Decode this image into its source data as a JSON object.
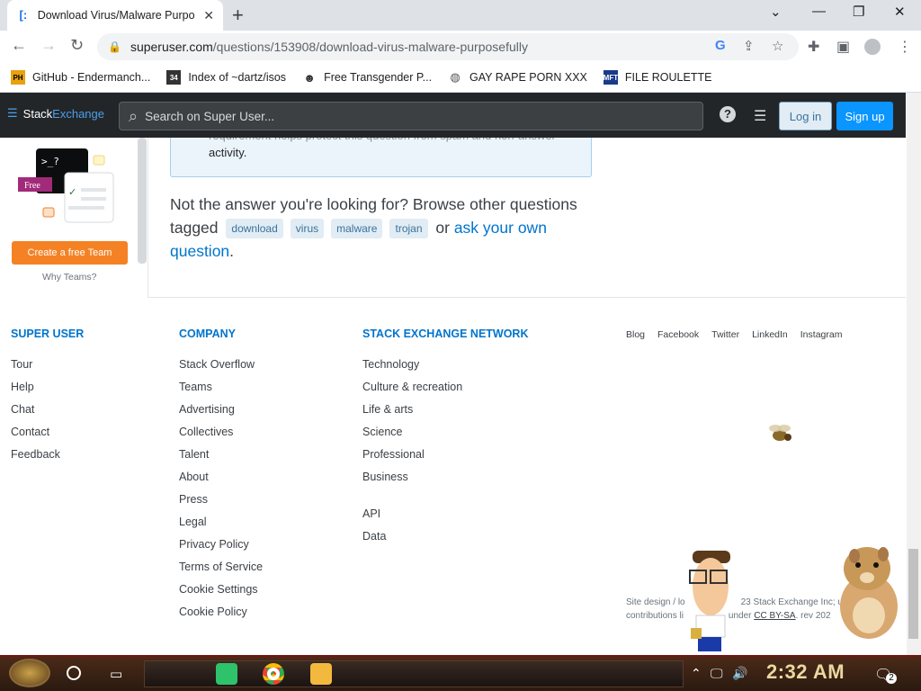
{
  "browser": {
    "tab_title": "Download Virus/Malware Purpos",
    "url_host": "superuser.com",
    "url_path": "/questions/153908/download-virus-malware-purposefully",
    "bookmarks": [
      {
        "label": "GitHub - Endermanch...",
        "icon": "PH"
      },
      {
        "label": "Index of ~dartz/isos",
        "icon": "34"
      },
      {
        "label": "Free Transgender P...",
        "icon": "mask"
      },
      {
        "label": "GAY RAPE PORN XXX",
        "icon": "globe"
      },
      {
        "label": "FILE ROULETTE",
        "icon": "MFT"
      }
    ]
  },
  "header": {
    "logo_stack": "Stack",
    "logo_exchange": "Exchange",
    "search_placeholder": "Search on Super User...",
    "login": "Log in",
    "signup": "Sign up"
  },
  "sidebar": {
    "free_badge": "Free",
    "prompt_glyph": ">_?",
    "create_team": "Create a free Team",
    "why_teams": "Why Teams?"
  },
  "main": {
    "notice_cut": "requirement helps protect this question from spam and non-answer",
    "notice_text": "activity.",
    "not_answer_prefix": "Not the answer you're looking for? Browse other questions tagged",
    "tags": [
      "download",
      "virus",
      "malware",
      "trojan"
    ],
    "or_text": "or",
    "ask_link": "ask your own question",
    "period": "."
  },
  "footer": {
    "col1_heading": "SUPER USER",
    "col1": [
      "Tour",
      "Help",
      "Chat",
      "Contact",
      "Feedback"
    ],
    "col2_heading": "COMPANY",
    "col2": [
      "Stack Overflow",
      "Teams",
      "Advertising",
      "Collectives",
      "Talent",
      "About",
      "Press",
      "Legal",
      "Privacy Policy",
      "Terms of Service",
      "Cookie Settings",
      "Cookie Policy"
    ],
    "col3_heading": "STACK EXCHANGE NETWORK",
    "col3": [
      "Technology",
      "Culture & recreation",
      "Life & arts",
      "Science",
      "Professional",
      "Business"
    ],
    "col3b": [
      "API",
      "Data"
    ],
    "social": [
      "Blog",
      "Facebook",
      "Twitter",
      "LinkedIn",
      "Instagram"
    ],
    "copyright_line1": "Site design / lo",
    "copyright_line1b": "23 Stack Exchange Inc; user",
    "copyright_line2": "contributions li",
    "copyright_line2b": "under",
    "license": "CC BY-SA",
    "rev": ". rev 202"
  },
  "taskbar": {
    "clock": "2:32 AM",
    "notification_count": "2"
  }
}
